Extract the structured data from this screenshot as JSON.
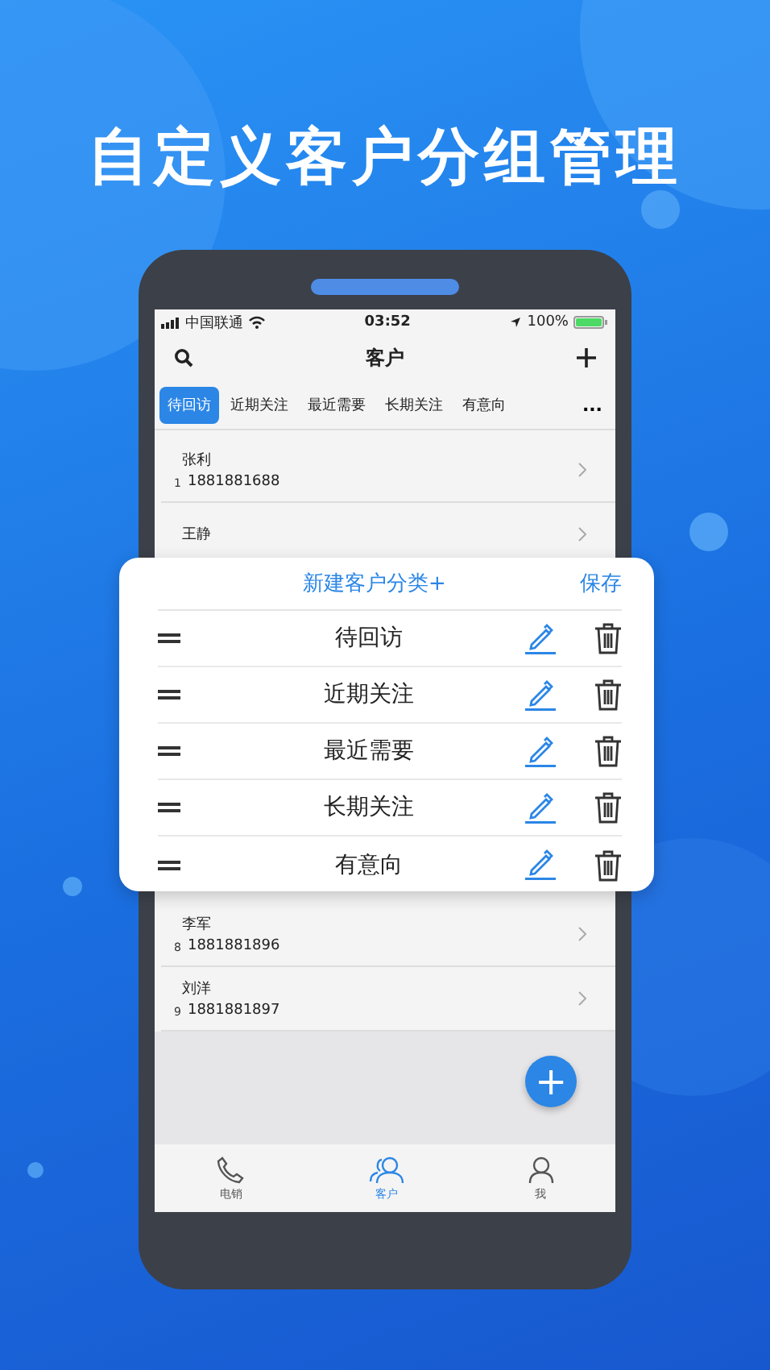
{
  "headline": "自定义客户分组管理",
  "status_bar": {
    "carrier": "中国联通",
    "time": "03:52",
    "battery": "100%"
  },
  "nav": {
    "title": "客户"
  },
  "tabs": [
    {
      "label": "待回访",
      "selected": true
    },
    {
      "label": "近期关注",
      "selected": false
    },
    {
      "label": "最近需要",
      "selected": false
    },
    {
      "label": "长期关注",
      "selected": false
    },
    {
      "label": "有意向",
      "selected": false
    }
  ],
  "more": "...",
  "customers_top": [
    {
      "index": "1",
      "name": "张利",
      "phone": "1881881688"
    },
    {
      "name": "王静"
    }
  ],
  "customers_bottom": [
    {
      "index": "8",
      "name": "李军",
      "phone": "1881881896"
    },
    {
      "index": "9",
      "name": "刘洋",
      "phone": "1881881897"
    }
  ],
  "fab": "+",
  "bottom_tabs": [
    {
      "label": "电销",
      "kind": "phone",
      "selected": false
    },
    {
      "label": "客户",
      "kind": "people",
      "selected": true
    },
    {
      "label": "我",
      "kind": "person",
      "selected": false
    }
  ],
  "dialog": {
    "new_category": "新建客户分类+",
    "save": "保存",
    "categories": [
      "待回访",
      "近期关注",
      "最近需要",
      "长期关注",
      "有意向"
    ]
  }
}
